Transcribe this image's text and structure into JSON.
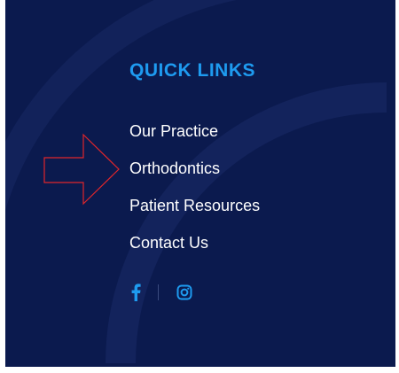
{
  "footer": {
    "heading": "QUICK LINKS",
    "links": [
      {
        "label": "Our Practice"
      },
      {
        "label": "Orthodontics"
      },
      {
        "label": "Patient Resources"
      },
      {
        "label": "Contact Us"
      }
    ],
    "social": [
      {
        "icon": "facebook-icon"
      },
      {
        "icon": "instagram-icon"
      }
    ]
  },
  "colors": {
    "background": "#0b1a4e",
    "heading": "#1e9bf0",
    "link_text": "#ffffff",
    "social_icons": "#1e9bf0",
    "annotation_arrow": "#e0262b"
  }
}
